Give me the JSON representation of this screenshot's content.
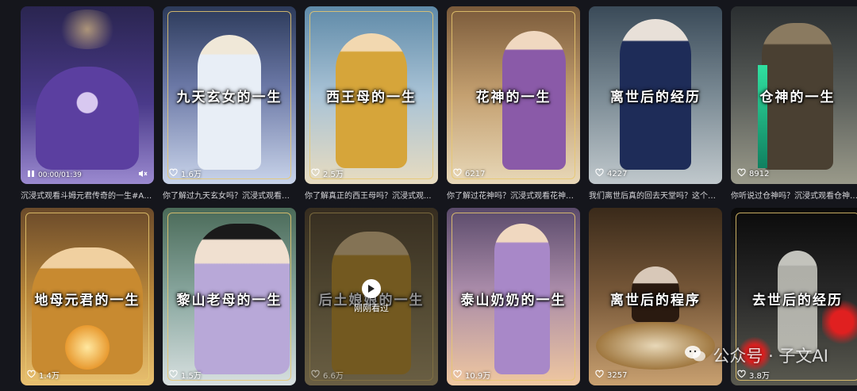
{
  "cards": [
    {
      "title": "",
      "likes": "",
      "caption": "沉浸式观看斗姆元君传奇的一生#AI#...",
      "colors": [
        "#2a2550",
        "#4a3a8a",
        "#9b8ad0"
      ],
      "figure": "#5b3fa0"
    },
    {
      "title": "九天玄女的一生",
      "likes": "1.6万",
      "caption": "你了解过九天玄女吗？沉浸式观看九...",
      "colors": [
        "#2c3a5a",
        "#6b78a6",
        "#c9d4ea"
      ],
      "figure": "#e8eef6"
    },
    {
      "title": "西王母的一生",
      "likes": "2.5万",
      "caption": "你了解真正的西王母吗？沉浸式观...",
      "colors": [
        "#5f8aa8",
        "#a9c3d6",
        "#e8dcc0"
      ],
      "figure": "#d6a53a"
    },
    {
      "title": "花神的一生",
      "likes": "6217",
      "caption": "你了解过花神吗？沉浸式观看花神传...",
      "colors": [
        "#7a5a3a",
        "#c4a070",
        "#e8d8b8"
      ],
      "figure": "#8a5aa8"
    },
    {
      "title": "离世后的经历",
      "likes": "4227",
      "caption": "我们离世后真的回去天堂吗？这个视...",
      "colors": [
        "#3a4a58",
        "#7a8a94",
        "#c0c8cc"
      ],
      "figure": "#1e2c58"
    },
    {
      "title": "仓神的一生",
      "likes": "8912",
      "caption": "你听说过仓神吗？沉浸式观看仓神传...",
      "colors": [
        "#2a2e30",
        "#5a5e5a",
        "#9a9a8a"
      ],
      "figure": "#4a4032"
    },
    {
      "title": "地母元君的一生",
      "likes": "1.4万",
      "caption": "",
      "colors": [
        "#6a4a2a",
        "#b8863a",
        "#e8c070"
      ],
      "figure": "#c88a30"
    },
    {
      "title": "黎山老母的一生",
      "likes": "1.5万",
      "caption": "",
      "colors": [
        "#4a6a58",
        "#8aa8a0",
        "#d8e0e0"
      ],
      "figure": "#b8a8d8"
    },
    {
      "title": "后土娘娘的一生",
      "likes": "6.6万",
      "caption": "",
      "colors": [
        "#5a4a30",
        "#8a7a50",
        "#b8a470"
      ],
      "figure": "#c89a30"
    },
    {
      "title": "泰山奶奶的一生",
      "likes": "10.9万",
      "caption": "",
      "colors": [
        "#5a4a6a",
        "#a88aa8",
        "#f0c8a0"
      ],
      "figure": "#a888c8"
    },
    {
      "title": "离世后的程序",
      "likes": "3257",
      "caption": "",
      "colors": [
        "#3a2a1a",
        "#7a5a3a",
        "#c8a070"
      ],
      "figure": "#2a1a10"
    },
    {
      "title": "去世后的经历",
      "likes": "3.8万",
      "caption": "",
      "colors": [
        "#0a0a0a",
        "#2a2a2a",
        "#5a5a50"
      ],
      "figure": "#c8c8c0"
    }
  ],
  "player": {
    "time": "00:00/01:39"
  },
  "watched": {
    "label": "刚刚看过"
  },
  "watermark": {
    "text": "公众号 · 子文AI"
  },
  "icons": {
    "heart": "heart-icon",
    "pause": "pause-icon",
    "mute": "mute-icon",
    "play": "play-icon",
    "wechat": "wechat-icon"
  },
  "accent": {
    "frame": "#e8c86e"
  }
}
